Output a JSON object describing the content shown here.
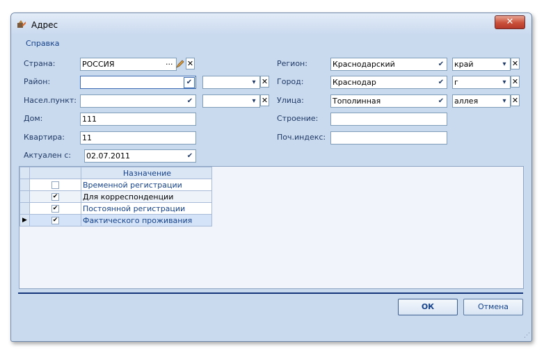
{
  "window": {
    "title": "Адрес",
    "close_label": "✕"
  },
  "menu": {
    "help": "Справка"
  },
  "labels": {
    "country": "Страна:",
    "district": "Район:",
    "settlement": "Насел.пункт:",
    "house": "Дом:",
    "apartment": "Квартира:",
    "actual_from": "Актуален с:",
    "region": "Регион:",
    "city": "Город:",
    "street": "Улица:",
    "building": "Строение:",
    "postcode": "Поч.индекс:"
  },
  "fields": {
    "country": "РОССИЯ",
    "district": "",
    "district_type": "",
    "settlement": "",
    "settlement_type": "",
    "house": "111",
    "apartment": "11",
    "actual_from": "02.07.2011",
    "region": "Краснодарский",
    "region_type": "край",
    "city": "Краснодар",
    "city_type": "г",
    "street": "Тополинная",
    "street_type": "аллея",
    "building": "",
    "postcode": ""
  },
  "grid": {
    "header": "Назначение",
    "rows": [
      {
        "checked": false,
        "name": "Временной регистрации"
      },
      {
        "checked": true,
        "name": "Для корреспонденции"
      },
      {
        "checked": true,
        "name": "Постоянной регистрации"
      },
      {
        "checked": true,
        "name": "Фактического проживания",
        "selected": true
      }
    ]
  },
  "buttons": {
    "ok": "ОК",
    "cancel": "Отмена"
  },
  "symbols": {
    "dropdown": "▾",
    "check": "✔",
    "clear": "✕",
    "ellipsis": "···",
    "row_indicator": "▶",
    "grip": "⋰"
  }
}
